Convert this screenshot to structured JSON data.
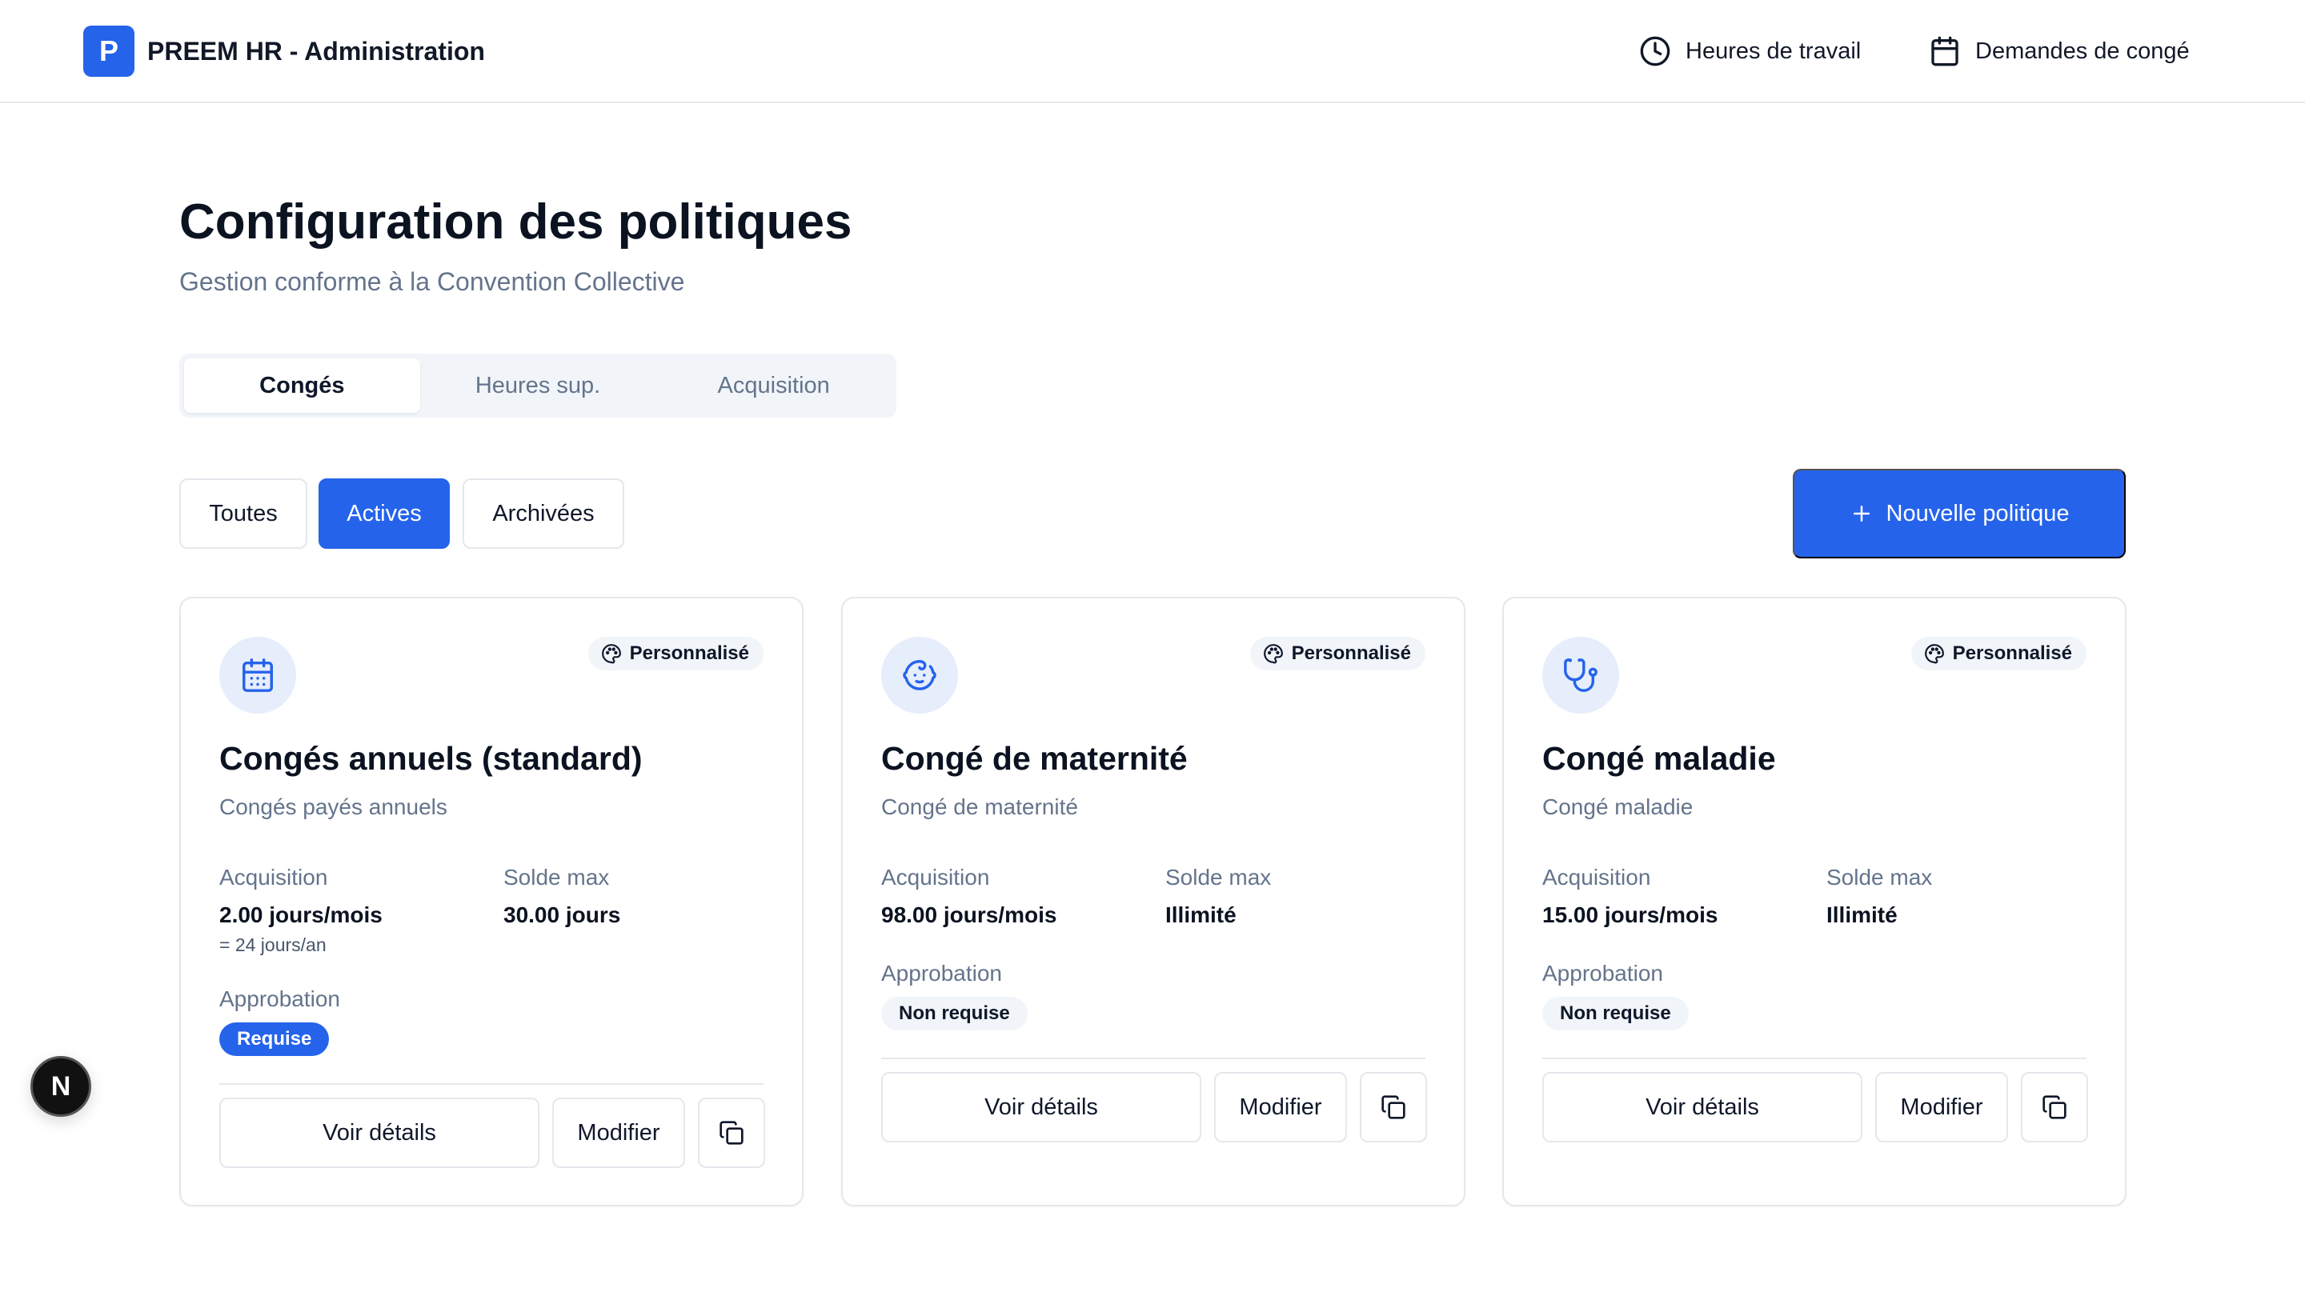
{
  "header": {
    "logo_letter": "P",
    "title": "PREEM HR - Administration",
    "nav": {
      "hours_label": "Heures de travail",
      "hours_icon": "clock-icon",
      "leave_label": "Demandes de congé",
      "leave_icon": "calendar-icon"
    }
  },
  "page": {
    "title": "Configuration des politiques",
    "subtitle": "Gestion conforme à la Convention Collective"
  },
  "tabs": [
    {
      "label": "Congés",
      "active": true
    },
    {
      "label": "Heures sup.",
      "active": false
    },
    {
      "label": "Acquisition",
      "active": false
    }
  ],
  "filters": {
    "all": "Toutes",
    "active": "Actives",
    "archived": "Archivées",
    "selected": "Actives"
  },
  "new_policy_label": "Nouvelle politique",
  "colors": {
    "accent": "#2563eb",
    "icon_bg": "#e6edfb",
    "muted_text": "#64748b",
    "border": "#e5e7eb"
  },
  "cards": [
    {
      "icon": "calendar-icon",
      "badge": "Personnalisé",
      "title": "Congés annuels (standard)",
      "description": "Congés payés annuels",
      "acq_label": "Acquisition",
      "acq_value": "2.00 jours/mois",
      "acq_note": "= 24 jours/an",
      "max_label": "Solde max",
      "max_value": "30.00 jours",
      "approval_label": "Approbation",
      "approval_value": "Requise",
      "view_label": "Voir détails",
      "edit_label": "Modifier"
    },
    {
      "icon": "baby-icon",
      "badge": "Personnalisé",
      "title": "Congé de maternité",
      "description": "Congé de maternité",
      "acq_label": "Acquisition",
      "acq_value": "98.00 jours/mois",
      "max_label": "Solde max",
      "max_value": "Illimité",
      "approval_label": "Approbation",
      "approval_value": "Non requise",
      "view_label": "Voir détails",
      "edit_label": "Modifier"
    },
    {
      "icon": "stethoscope-icon",
      "badge": "Personnalisé",
      "title": "Congé maladie",
      "description": "Congé maladie",
      "acq_label": "Acquisition",
      "acq_value": "15.00 jours/mois",
      "max_label": "Solde max",
      "max_value": "Illimité",
      "approval_label": "Approbation",
      "approval_value": "Non requise",
      "view_label": "Voir détails",
      "edit_label": "Modifier"
    }
  ],
  "dev_badge_letter": "N"
}
